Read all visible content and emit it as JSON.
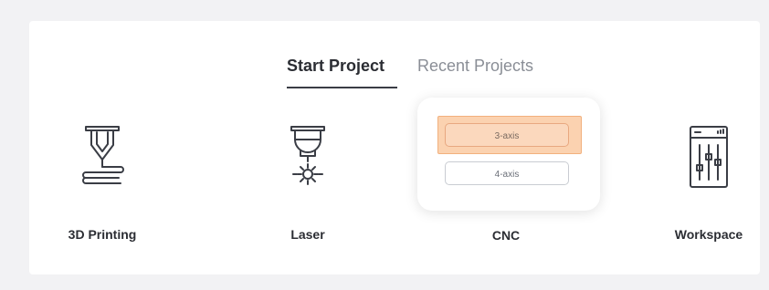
{
  "tabs": {
    "start_project": "Start Project",
    "recent_projects": "Recent Projects"
  },
  "cards": {
    "printing": {
      "label": "3D Printing",
      "icon": "3d-printer-nozzle-icon"
    },
    "laser": {
      "label": "Laser",
      "icon": "laser-head-icon"
    },
    "cnc": {
      "label": "CNC",
      "icon": "cnc-options",
      "options": [
        "3-axis",
        "4-axis"
      ],
      "highlighted_option": "3-axis"
    },
    "workspace": {
      "label": "Workspace",
      "icon": "workspace-sliders-icon"
    }
  },
  "colors": {
    "accent_highlight": "#fbd2b0",
    "text": "#2b2d33",
    "muted": "#8a8e96"
  }
}
